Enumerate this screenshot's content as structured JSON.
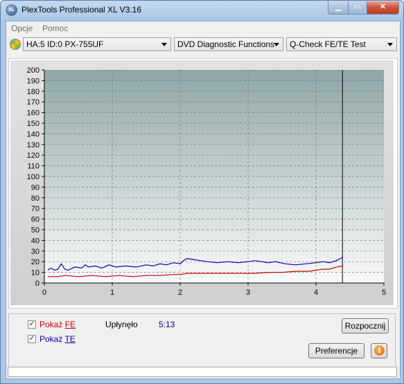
{
  "window": {
    "title": "PlexTools Professional XL V3.16",
    "icon_label": "XL"
  },
  "menu": {
    "items": [
      "Opcje",
      "Pomoc"
    ]
  },
  "toolbar": {
    "drive": "HA:5 ID:0  PX-755UF",
    "function": "DVD Diagnostic Functions",
    "test": "Q-Check FE/TE Test"
  },
  "chart_data": {
    "type": "line",
    "xlim": [
      0,
      5
    ],
    "ylim": [
      0,
      200
    ],
    "x_ticks": [
      "0",
      "1",
      "2",
      "3",
      "4",
      "5"
    ],
    "y_ticks": [
      "0",
      "10",
      "20",
      "30",
      "40",
      "50",
      "60",
      "70",
      "80",
      "90",
      "100",
      "110",
      "120",
      "130",
      "140",
      "150",
      "160",
      "170",
      "180",
      "190",
      "200"
    ],
    "grid": true,
    "end_marker_x": 4.39,
    "series": [
      {
        "color": "#0000b0",
        "x": [
          0.05,
          0.1,
          0.15,
          0.2,
          0.25,
          0.3,
          0.35,
          0.45,
          0.55,
          0.6,
          0.65,
          0.75,
          0.85,
          0.95,
          1.05,
          1.2,
          1.35,
          1.5,
          1.6,
          1.7,
          1.8,
          1.9,
          2.0,
          2.05,
          2.1,
          2.2,
          2.3,
          2.4,
          2.55,
          2.7,
          2.85,
          3.0,
          3.1,
          3.2,
          3.3,
          3.4,
          3.55,
          3.7,
          3.85,
          4.0,
          4.1,
          4.2,
          4.3,
          4.39
        ],
        "y": [
          12,
          14,
          12,
          13,
          18,
          13,
          12,
          15,
          14,
          17,
          15,
          16,
          14,
          17,
          15,
          16,
          15,
          17,
          16,
          18,
          17,
          19,
          18,
          21,
          23,
          22,
          21,
          20,
          19,
          20,
          19,
          20,
          21,
          20,
          19,
          20,
          18,
          17,
          18,
          19,
          20,
          19,
          21,
          24
        ]
      },
      {
        "color": "#d00000",
        "x": [
          0.05,
          0.2,
          0.3,
          0.5,
          0.7,
          0.9,
          1.1,
          1.3,
          1.5,
          1.7,
          1.9,
          2.0,
          2.1,
          2.3,
          2.5,
          2.7,
          2.9,
          3.1,
          3.3,
          3.5,
          3.7,
          3.9,
          4.0,
          4.1,
          4.2,
          4.3,
          4.39
        ],
        "y": [
          6,
          6,
          7,
          6,
          7,
          6,
          7,
          6,
          7,
          7,
          8,
          8,
          9,
          9,
          9,
          9,
          9,
          9,
          10,
          10,
          11,
          11,
          12,
          13,
          13,
          15,
          16
        ]
      }
    ]
  },
  "bottom": {
    "show_fe_prefix": "Pokaż ",
    "show_fe_key": "FE",
    "show_te_prefix": "Pokaż ",
    "show_te_key": "TE",
    "elapsed_label": "Upłynęło",
    "elapsed_value": "5:13",
    "start_button": "Rozpocznij",
    "preferences_button": "Preferencje"
  },
  "status": {
    "text": ""
  }
}
